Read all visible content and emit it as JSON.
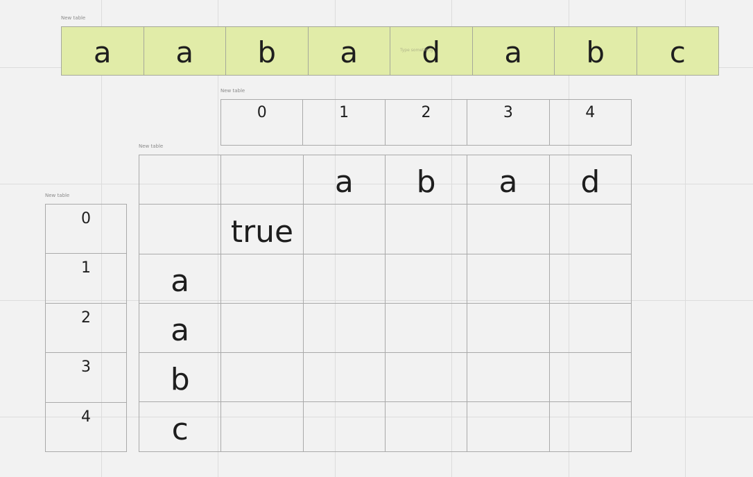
{
  "tables": {
    "string": {
      "label": "New table",
      "cells": [
        "a",
        "a",
        "b",
        "a",
        "d",
        "a",
        "b",
        "c"
      ],
      "placeholder": "Type something",
      "fill": "#e1eca8"
    },
    "col_index": {
      "label": "New table",
      "cells": [
        "0",
        "1",
        "2",
        "3",
        "4"
      ]
    },
    "dp": {
      "label": "New table",
      "header": [
        "",
        "",
        "a",
        "b",
        "a",
        "d"
      ],
      "rows": [
        [
          "",
          "true",
          "",
          "",
          "",
          ""
        ],
        [
          "a",
          "",
          "",
          "",
          "",
          ""
        ],
        [
          "a",
          "",
          "",
          "",
          "",
          ""
        ],
        [
          "b",
          "",
          "",
          "",
          "",
          ""
        ],
        [
          "c",
          "",
          "",
          "",
          "",
          ""
        ]
      ]
    },
    "row_index": {
      "label": "New table",
      "cells": [
        "0",
        "1",
        "2",
        "3",
        "4"
      ]
    }
  }
}
